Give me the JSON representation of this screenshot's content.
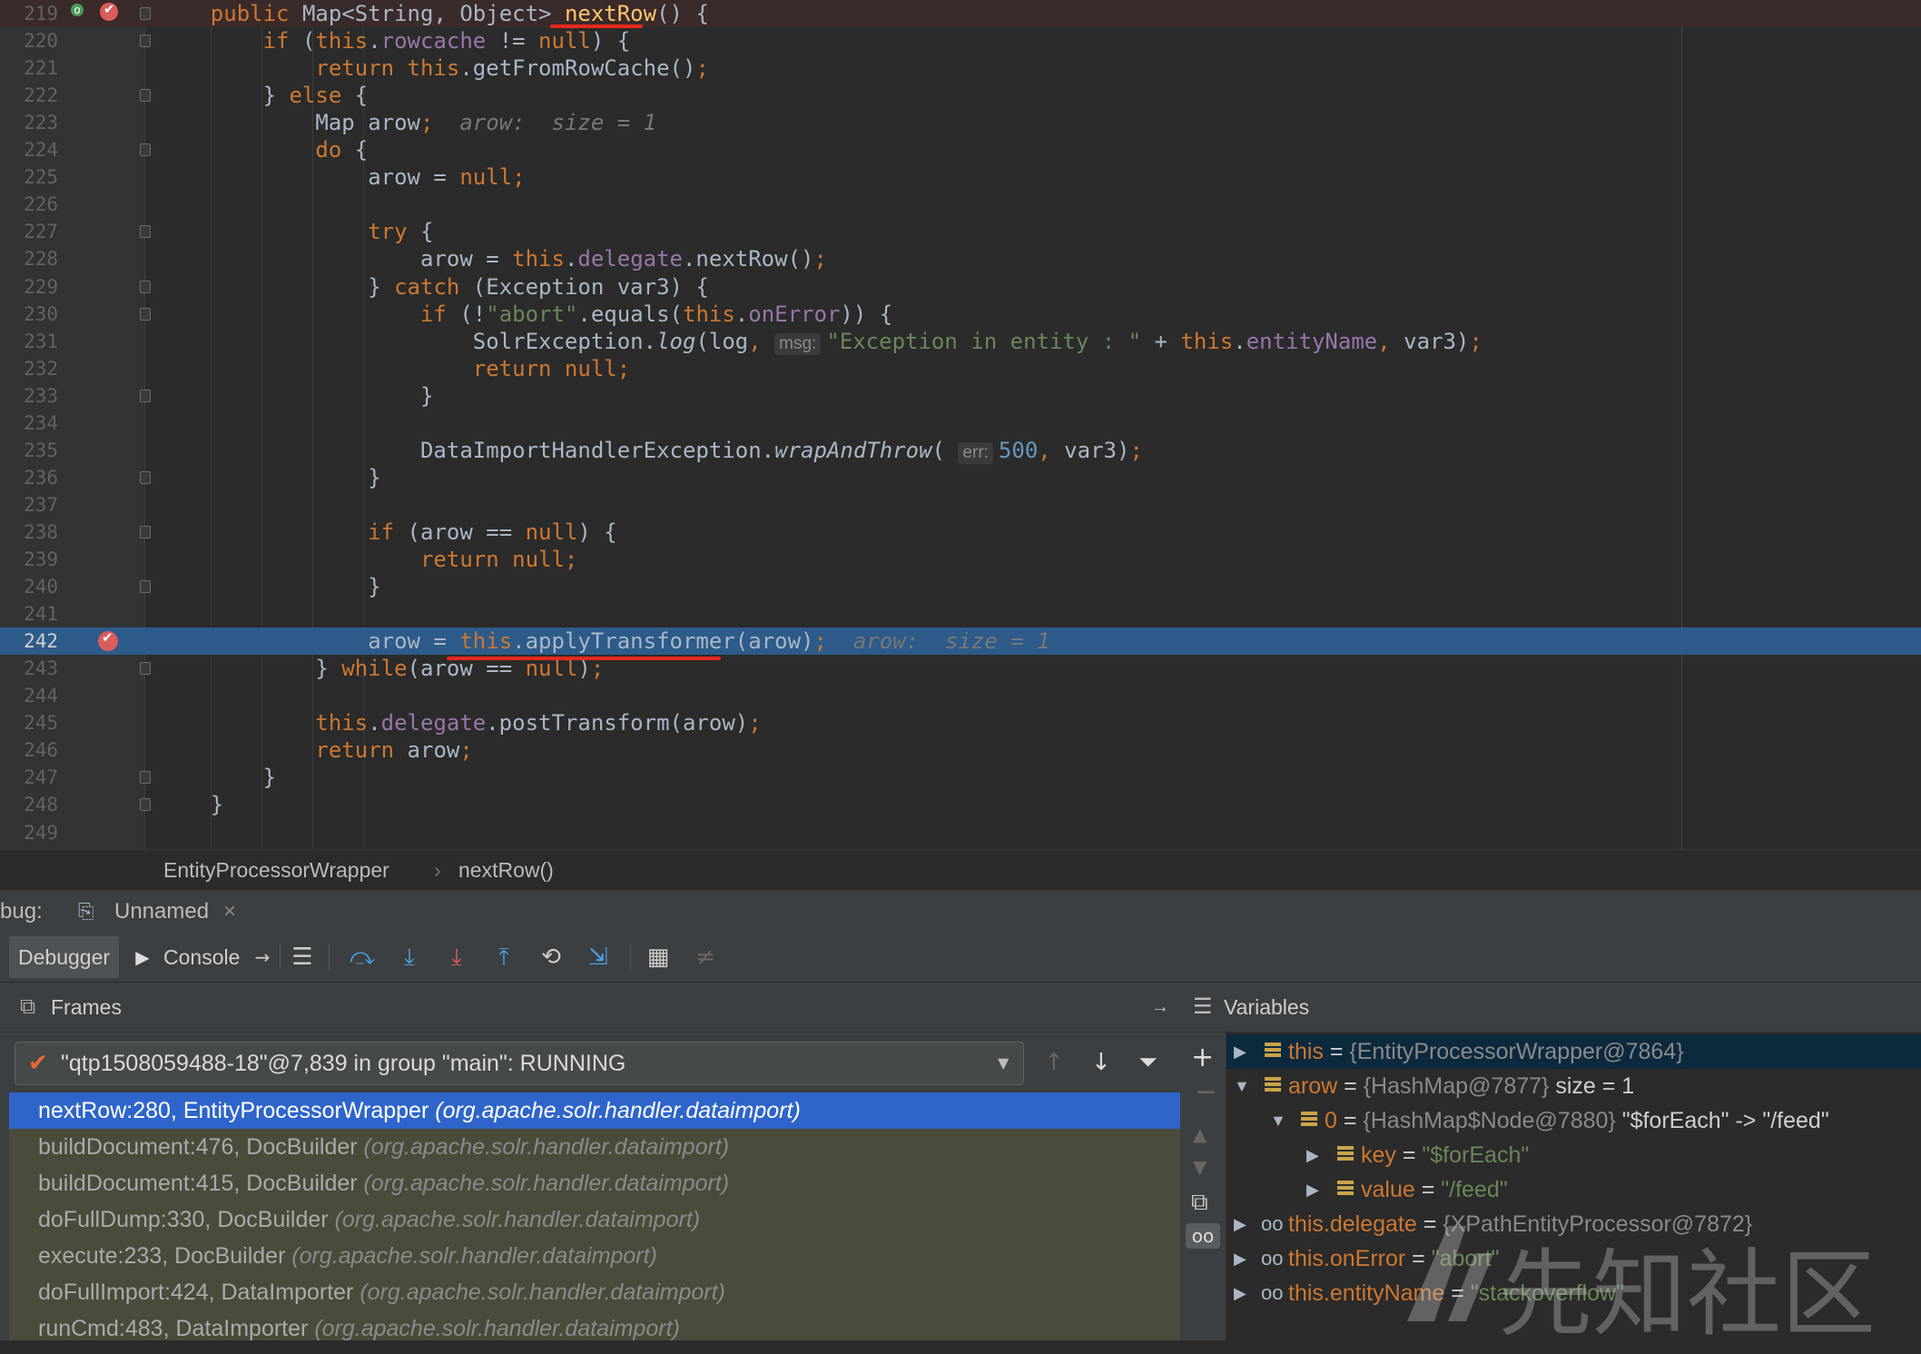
{
  "editor": {
    "lines": [
      {
        "no": "219",
        "code": "    <span class=\"k\">public</span> Map&lt;String, Object&gt; <span class=\"f\">nextRow</span>() {"
      },
      {
        "no": "220",
        "code": "        <span class=\"k\">if</span> (<span class=\"k\">this</span>.<span class=\"m\">rowcache</span> != <span class=\"k\">null</span>) {"
      },
      {
        "no": "221",
        "code": "            <span class=\"k\">return this</span>.getFromRowCache()<span class=\"k\">;</span>"
      },
      {
        "no": "222",
        "code": "        } <span class=\"k\">else</span> {"
      },
      {
        "no": "223",
        "code": "            Map arow<span class=\"k\">;</span>  <span class=\"hint\">arow:  size = 1</span>"
      },
      {
        "no": "224",
        "code": "            <span class=\"k\">do</span> {"
      },
      {
        "no": "225",
        "code": "                arow = <span class=\"k\">null;</span>"
      },
      {
        "no": "226",
        "code": ""
      },
      {
        "no": "227",
        "code": "                <span class=\"k\">try</span> {"
      },
      {
        "no": "228",
        "code": "                    arow = <span class=\"k\">this</span>.<span class=\"m\">delegate</span>.nextRow()<span class=\"k\">;</span>"
      },
      {
        "no": "229",
        "code": "                } <span class=\"k\">catch</span> (Exception var3) {"
      },
      {
        "no": "230",
        "code": "                    <span class=\"k\">if</span> (!<span class=\"s\">\"abort\"</span>.equals(<span class=\"k\">this</span>.<span class=\"m\">onError</span>)) {"
      },
      {
        "no": "231",
        "code": "                        SolrException.<i>log</i>(log<span class=\"k\">,</span> <span class=\"param\">msg:</span><span class=\"s\">\"Exception in entity : \"</span> + <span class=\"k\">this</span>.<span class=\"m\">entityName</span><span class=\"k\">,</span> var3)<span class=\"k\">;</span>"
      },
      {
        "no": "232",
        "code": "                        <span class=\"k\">return null;</span>"
      },
      {
        "no": "233",
        "code": "                    }"
      },
      {
        "no": "234",
        "code": ""
      },
      {
        "no": "235",
        "code": "                    DataImportHandlerException.<i>wrapAndThrow</i>( <span class=\"param\">err:</span><span class=\"n\">500</span><span class=\"k\">,</span> var3)<span class=\"k\">;</span>"
      },
      {
        "no": "236",
        "code": "                }"
      },
      {
        "no": "237",
        "code": ""
      },
      {
        "no": "238",
        "code": "                <span class=\"k\">if</span> (arow == <span class=\"k\">null</span>) {"
      },
      {
        "no": "239",
        "code": "                    <span class=\"k\">return null;</span>"
      },
      {
        "no": "240",
        "code": "                }"
      },
      {
        "no": "241",
        "code": ""
      },
      {
        "no": "242",
        "code": "                arow = <span class=\"k\">this</span>.applyTransformer(arow)<span class=\"k\">;</span>  <span class=\"hint\">arow:  size = 1</span>"
      },
      {
        "no": "243",
        "code": "            } <span class=\"k\">while</span>(arow == <span class=\"k\">null</span>)<span class=\"k\">;</span>"
      },
      {
        "no": "244",
        "code": ""
      },
      {
        "no": "245",
        "code": "            <span class=\"k\">this</span>.<span class=\"m\">delegate</span>.postTransform(arow)<span class=\"k\">;</span>"
      },
      {
        "no": "246",
        "code": "            <span class=\"k\">return</span> arow<span class=\"k\">;</span>"
      },
      {
        "no": "247",
        "code": "        }"
      },
      {
        "no": "248",
        "code": "    }"
      },
      {
        "no": "249",
        "code": ""
      }
    ]
  },
  "breadcrumb": {
    "class_name": "EntityProcessorWrapper",
    "separator": "›",
    "method": "nextRow()"
  },
  "debug_bar": {
    "prefix": "bug:",
    "session_name": "Unnamed",
    "close_glyph": "×"
  },
  "toolbar": {
    "debugger_tab": "Debugger",
    "console_tab": "Console"
  },
  "frames": {
    "title": "Frames",
    "thread": "\"qtp1508059488-18\"@7,839 in group \"main\": RUNNING",
    "items": [
      {
        "loc": "nextRow:280, EntityProcessorWrapper",
        "pkg": "(org.apache.solr.handler.dataimport)"
      },
      {
        "loc": "buildDocument:476, DocBuilder",
        "pkg": "(org.apache.solr.handler.dataimport)"
      },
      {
        "loc": "buildDocument:415, DocBuilder",
        "pkg": "(org.apache.solr.handler.dataimport)"
      },
      {
        "loc": "doFullDump:330, DocBuilder",
        "pkg": "(org.apache.solr.handler.dataimport)"
      },
      {
        "loc": "execute:233, DocBuilder",
        "pkg": "(org.apache.solr.handler.dataimport)"
      },
      {
        "loc": "doFullImport:424, DataImporter",
        "pkg": "(org.apache.solr.handler.dataimport)"
      },
      {
        "loc": "runCmd:483, DataImporter",
        "pkg": "(org.apache.solr.handler.dataimport)"
      }
    ]
  },
  "variables": {
    "title": "Variables",
    "items": [
      {
        "name": "this",
        "eq": " = ",
        "type": "{EntityProcessorWrapper@7864}",
        "extra": "",
        "str": ""
      },
      {
        "name": "arow",
        "eq": " = ",
        "type": "{HashMap@7877}",
        "extra": "  size = 1",
        "str": ""
      },
      {
        "name": "0",
        "eq": " = ",
        "type": "{HashMap$Node@7880}",
        "extra": " \"$forEach\" -> \"/feed\"",
        "str": ""
      },
      {
        "name": "key",
        "eq": " = ",
        "type": "",
        "extra": "",
        "str": "\"$forEach\""
      },
      {
        "name": "value",
        "eq": " = ",
        "type": "",
        "extra": "",
        "str": "\"/feed\""
      },
      {
        "name": "this.delegate",
        "eq": " = ",
        "type": "{XPathEntityProcessor@7872}",
        "extra": "",
        "str": ""
      },
      {
        "name": "this.onError",
        "eq": " = ",
        "type": "",
        "extra": "",
        "str": "\"abort\""
      },
      {
        "name": "this.entityName",
        "eq": " = ",
        "type": "",
        "extra": "",
        "str": "\"stackoverflow\""
      }
    ]
  },
  "watermark": {
    "text": "先知社区"
  },
  "colors": {
    "accent": "#2f65ca",
    "exec_line": "#2d5b8a",
    "breakpoint": "#db5c5c",
    "underline": "#e8281c"
  }
}
